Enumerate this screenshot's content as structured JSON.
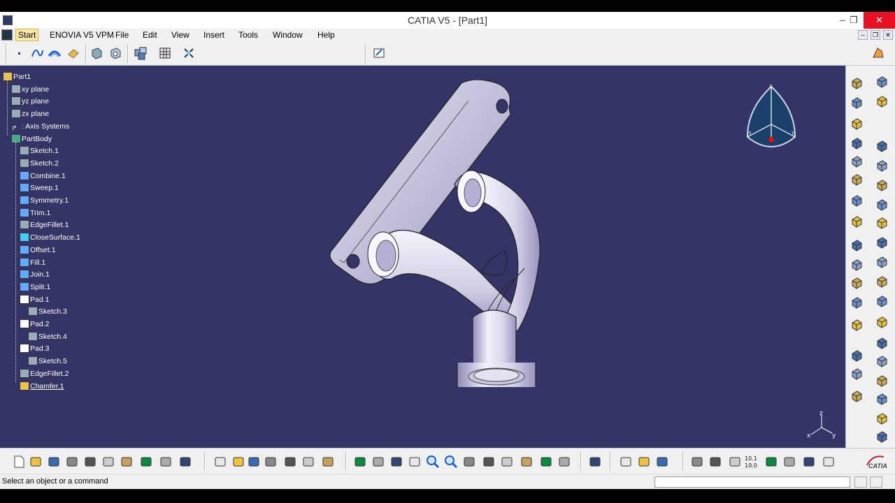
{
  "window": {
    "title": "CATIA V5 - [Part1]",
    "min_label": "–",
    "max_label": "❐",
    "close_label": "✕"
  },
  "menu": {
    "items": [
      "Start",
      "ENOVIA V5 VPM",
      "File",
      "Edit",
      "View",
      "Insert",
      "Tools",
      "Window",
      "Help"
    ]
  },
  "tree": {
    "nodes": [
      {
        "label": "Part1",
        "icon": "part-icon"
      },
      {
        "label": "xy plane",
        "icon": "plane-icon"
      },
      {
        "label": "yz plane",
        "icon": "plane-icon"
      },
      {
        "label": "zx plane",
        "icon": "plane-icon"
      },
      {
        "label": ": Axis Systems",
        "icon": "axis-systems-icon"
      },
      {
        "label": "PartBody",
        "icon": "partbody-icon"
      },
      {
        "label": "Sketch.1",
        "icon": "sketch-icon"
      },
      {
        "label": "Sketch.2",
        "icon": "sketch-icon"
      },
      {
        "label": "Combine.1",
        "icon": "combine-icon"
      },
      {
        "label": "Sweep.1",
        "icon": "sweep-icon"
      },
      {
        "label": "Symmetry.1",
        "icon": "symmetry-icon"
      },
      {
        "label": "Trim.1",
        "icon": "trim-icon"
      },
      {
        "label": "EdgeFillet.1",
        "icon": "edgefillet-icon"
      },
      {
        "label": "CloseSurface.1",
        "icon": "closesurface-icon"
      },
      {
        "label": "Offset.1",
        "icon": "offset-icon"
      },
      {
        "label": "Fill.1",
        "icon": "fill-icon"
      },
      {
        "label": "Join.1",
        "icon": "join-icon"
      },
      {
        "label": "Split.1",
        "icon": "split-icon"
      },
      {
        "label": "Pad.1",
        "icon": "pad-icon"
      },
      {
        "label": "Sketch.3",
        "icon": "sketch-icon"
      },
      {
        "label": "Pad.2",
        "icon": "pad-icon"
      },
      {
        "label": "Sketch.4",
        "icon": "sketch-icon"
      },
      {
        "label": "Pad.3",
        "icon": "pad-icon"
      },
      {
        "label": "Sketch.5",
        "icon": "sketch-icon"
      },
      {
        "label": "EdgeFillet.2",
        "icon": "edgefillet-icon"
      },
      {
        "label": "Chamfer.1",
        "icon": "chamfer-icon"
      }
    ]
  },
  "compass": {
    "z": "z",
    "x": "x",
    "y": "y"
  },
  "axis_triad": {
    "z": "z",
    "x": "x",
    "y": "y"
  },
  "toolbar_bottom": {
    "calc_label": "10.1\n10.0"
  },
  "status": {
    "message": "Select an object or a command",
    "command_input_placeholder": ""
  },
  "branding": {
    "logo_text": "CATIA"
  },
  "colors": {
    "viewport_bg": "#353466",
    "selection_highlight": "#ffe8a6",
    "close_button": "#e81123"
  }
}
